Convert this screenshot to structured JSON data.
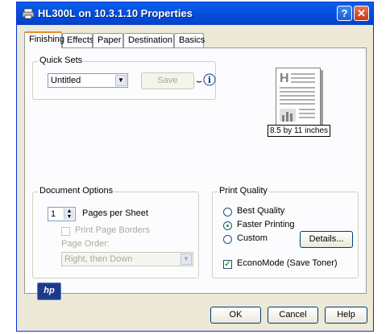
{
  "window": {
    "title": "HL300L on 10.3.1.10 Properties"
  },
  "tabs": [
    {
      "label": "Finishing",
      "active": true
    },
    {
      "label": "Effects"
    },
    {
      "label": "Paper"
    },
    {
      "label": "Destination"
    },
    {
      "label": "Basics"
    }
  ],
  "quick_sets": {
    "title": "Quick Sets",
    "selected": "Untitled",
    "save_label": "Save"
  },
  "preview": {
    "paper_size": "8.5 by 11 inches"
  },
  "document_options": {
    "title": "Document Options",
    "pages_per_sheet_value": "1",
    "pages_per_sheet_label": "Pages per Sheet",
    "print_page_borders": "Print Page Borders",
    "page_order_label": "Page Order:",
    "page_order_value": "Right, then Down"
  },
  "print_quality": {
    "title": "Print Quality",
    "options": [
      "Best Quality",
      "Faster Printing",
      "Custom"
    ],
    "selected": "Faster Printing",
    "details_label": "Details...",
    "econo_label": "EconoMode (Save Toner)",
    "econo_checked": true
  },
  "logo_text": "hp",
  "buttons": {
    "ok": "OK",
    "cancel": "Cancel",
    "help": "Help"
  },
  "colors": {
    "titlebar": "#0054e3",
    "window_bg": "#ece9d8",
    "tab_accent": "#e68b2c"
  }
}
